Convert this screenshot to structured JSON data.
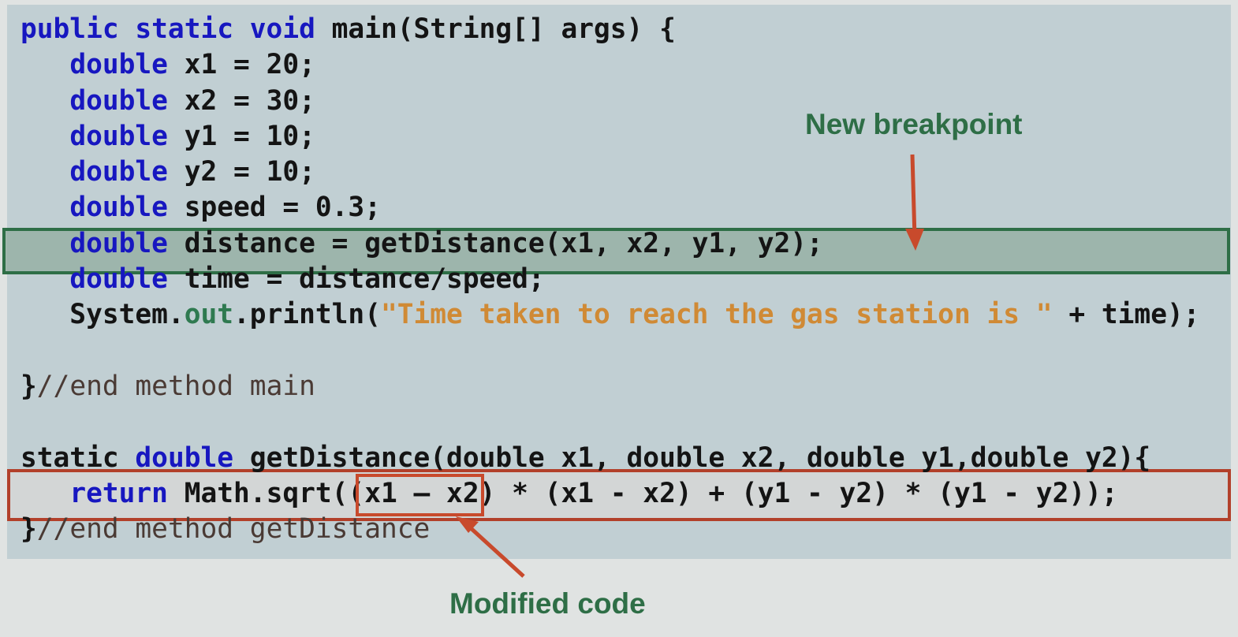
{
  "code": {
    "lines": [
      [
        {
          "t": "public static void ",
          "k": "kw"
        },
        {
          "t": "main(String[] args) {",
          "k": "plain"
        }
      ],
      [
        {
          "t": "   ",
          "k": "plain"
        },
        {
          "t": "double ",
          "k": "kw"
        },
        {
          "t": "x1 = 20;",
          "k": "plain"
        }
      ],
      [
        {
          "t": "   ",
          "k": "plain"
        },
        {
          "t": "double ",
          "k": "kw"
        },
        {
          "t": "x2 = 30;",
          "k": "plain"
        }
      ],
      [
        {
          "t": "   ",
          "k": "plain"
        },
        {
          "t": "double ",
          "k": "kw"
        },
        {
          "t": "y1 = 10;",
          "k": "plain"
        }
      ],
      [
        {
          "t": "   ",
          "k": "plain"
        },
        {
          "t": "double ",
          "k": "kw"
        },
        {
          "t": "y2 = 10;",
          "k": "plain"
        }
      ],
      [
        {
          "t": "   ",
          "k": "plain"
        },
        {
          "t": "double ",
          "k": "kw"
        },
        {
          "t": "speed = 0.3;",
          "k": "plain"
        }
      ],
      [
        {
          "t": "   ",
          "k": "plain"
        },
        {
          "t": "double ",
          "k": "kw"
        },
        {
          "t": "distance = getDistance(x1, x2, y1, y2);",
          "k": "plain"
        }
      ],
      [
        {
          "t": "   ",
          "k": "plain"
        },
        {
          "t": "double ",
          "k": "kw"
        },
        {
          "t": "time = distance/speed;",
          "k": "plain"
        }
      ],
      [
        {
          "t": "   System.",
          "k": "plain"
        },
        {
          "t": "out",
          "k": "field"
        },
        {
          "t": ".println(",
          "k": "plain"
        },
        {
          "t": "\"Time taken to reach the gas station is \"",
          "k": "str"
        },
        {
          "t": " + time);",
          "k": "plain"
        }
      ],
      [],
      [
        {
          "t": "}",
          "k": "plain"
        },
        {
          "t": "//end method main",
          "k": "comment"
        }
      ],
      [],
      [
        {
          "t": "static ",
          "k": "plain"
        },
        {
          "t": "double ",
          "k": "kw"
        },
        {
          "t": "getDistance(double x1, double x2, double y1,double y2){",
          "k": "plain"
        }
      ],
      [
        {
          "t": "   ",
          "k": "plain"
        },
        {
          "t": "return ",
          "k": "kw"
        },
        {
          "t": "Math.sqrt((x1 – x2) * (x1 - x2) + (y1 - y2) * (y1 - y2));",
          "k": "plain"
        }
      ],
      [
        {
          "t": "}",
          "k": "plain"
        },
        {
          "t": "//end method getDistance",
          "k": "comment"
        }
      ]
    ]
  },
  "annotations": {
    "new_breakpoint_label": "New breakpoint",
    "modified_code_label": "Modified code"
  },
  "colors": {
    "keyword": "#1717c0",
    "field": "#2f7a50",
    "string": "#d08a35",
    "comment": "#4a3a34",
    "breakpoint_border": "#2e6e46",
    "modified_border": "#b2402a",
    "arrow": "#c84a2c"
  }
}
